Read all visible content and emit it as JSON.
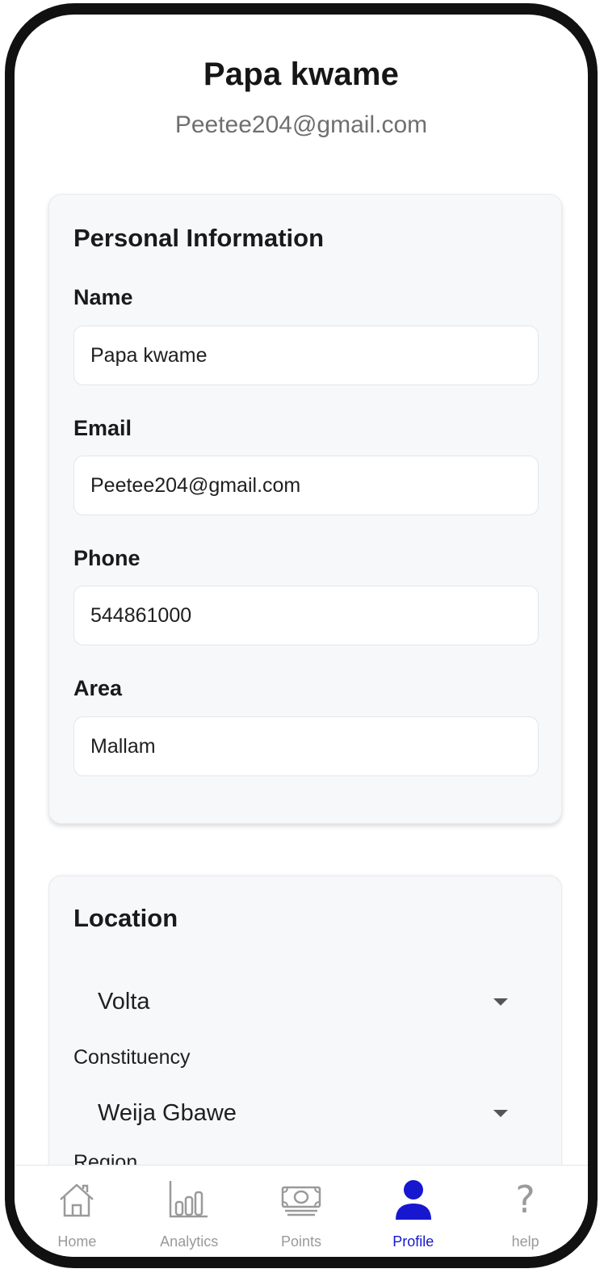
{
  "profile": {
    "name": "Papa kwame",
    "email": "Peetee204@gmail.com"
  },
  "personal_info": {
    "title": "Personal Information",
    "fields": [
      {
        "label": "Name",
        "value": "Papa kwame"
      },
      {
        "label": "Email",
        "value": "Peetee204@gmail.com"
      },
      {
        "label": "Phone",
        "value": "544861000"
      },
      {
        "label": "Area",
        "value": "Mallam"
      }
    ]
  },
  "location": {
    "title": "Location",
    "region_select": {
      "value": "Volta"
    },
    "constituency_label": "Constituency",
    "constituency_select": {
      "value": "Weija Gbawe"
    },
    "clipped_label": "Region"
  },
  "bottom_nav": {
    "items": [
      {
        "label": "Home",
        "icon": "home-icon"
      },
      {
        "label": "Analytics",
        "icon": "bar-chart-icon"
      },
      {
        "label": "Points",
        "icon": "money-icon"
      },
      {
        "label": "Profile",
        "icon": "person-icon",
        "active": true
      },
      {
        "label": "help",
        "icon": "question-icon"
      }
    ]
  },
  "colors": {
    "accent": "#1717cf",
    "card_background": "#f6f8fa",
    "nav_inactive": "#9a9a9a"
  }
}
